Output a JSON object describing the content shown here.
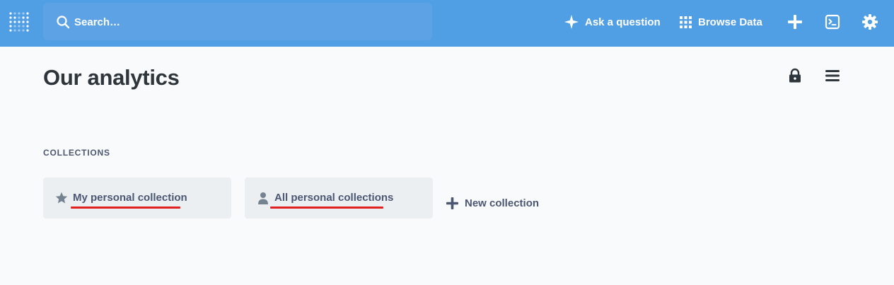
{
  "nav": {
    "search_placeholder": "Search…",
    "ask_label": "Ask a question",
    "browse_label": "Browse Data"
  },
  "page": {
    "title": "Our analytics"
  },
  "collections": {
    "section_label": "COLLECTIONS",
    "items": [
      {
        "label": "My personal collection",
        "icon": "star-icon"
      },
      {
        "label": "All personal collections",
        "icon": "person-icon"
      }
    ],
    "new_label": "New collection"
  },
  "colors": {
    "nav_bg": "#509ee3",
    "card_bg": "#ebeff2",
    "annotation_underline": "#e0211d"
  }
}
